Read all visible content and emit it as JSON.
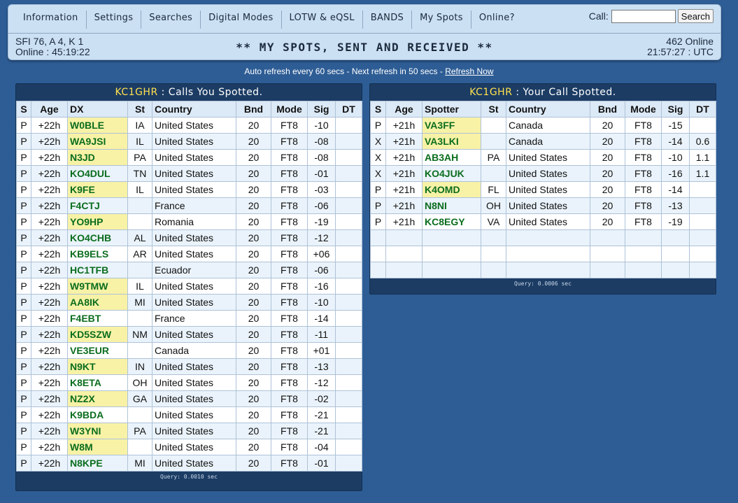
{
  "nav": [
    "Information",
    "Settings",
    "Searches",
    "Digital Modes",
    "LOTW & eQSL",
    "BANDS",
    "My Spots",
    "Online?"
  ],
  "search": {
    "label": "Call:",
    "value": "",
    "button": "Search"
  },
  "solar": {
    "line1": "SFI 76, A 4, K 1",
    "line2": "Online : 45:19:22"
  },
  "title": "** MY SPOTS, SENT AND RECEIVED **",
  "status": {
    "online": "462 Online",
    "time": "21:57:27 : UTC"
  },
  "refresh": {
    "text": "Auto refresh every 60 secs - Next refresh in 50 secs - ",
    "link": "Refresh Now"
  },
  "colors": {
    "background": "#2e5d95",
    "header": "#cbe0f3",
    "panel": "#1c3c64",
    "callsign": "#ffe14d",
    "dx_text": "#0b6d1e",
    "highlight": "#f8f2a6"
  },
  "left": {
    "callsign": "KC1GHR",
    "title": " : Calls You Spotted.",
    "columns": [
      "S",
      "Age",
      "DX",
      "St",
      "Country",
      "Bnd",
      "Mode",
      "Sig",
      "DT"
    ],
    "query": "Query: 0.0010 sec",
    "rows": [
      {
        "s": "P",
        "age": "+22h",
        "call": "W0BLE",
        "st": "IA",
        "country": "United States",
        "band": "20",
        "mode": "FT8",
        "sig": "-10",
        "dt": "",
        "hl": true
      },
      {
        "s": "P",
        "age": "+22h",
        "call": "WA9JSI",
        "st": "IL",
        "country": "United States",
        "band": "20",
        "mode": "FT8",
        "sig": "-08",
        "dt": "",
        "hl": true
      },
      {
        "s": "P",
        "age": "+22h",
        "call": "N3JD",
        "st": "PA",
        "country": "United States",
        "band": "20",
        "mode": "FT8",
        "sig": "-08",
        "dt": "",
        "hl": true
      },
      {
        "s": "P",
        "age": "+22h",
        "call": "KO4DUL",
        "st": "TN",
        "country": "United States",
        "band": "20",
        "mode": "FT8",
        "sig": "-01",
        "dt": "",
        "hl": false
      },
      {
        "s": "P",
        "age": "+22h",
        "call": "K9FE",
        "st": "IL",
        "country": "United States",
        "band": "20",
        "mode": "FT8",
        "sig": "-03",
        "dt": "",
        "hl": true
      },
      {
        "s": "P",
        "age": "+22h",
        "call": "F4CTJ",
        "st": "",
        "country": "France",
        "band": "20",
        "mode": "FT8",
        "sig": "-06",
        "dt": "",
        "hl": false
      },
      {
        "s": "P",
        "age": "+22h",
        "call": "YO9HP",
        "st": "",
        "country": "Romania",
        "band": "20",
        "mode": "FT8",
        "sig": "-19",
        "dt": "",
        "hl": true
      },
      {
        "s": "P",
        "age": "+22h",
        "call": "KO4CHB",
        "st": "AL",
        "country": "United States",
        "band": "20",
        "mode": "FT8",
        "sig": "-12",
        "dt": "",
        "hl": false
      },
      {
        "s": "P",
        "age": "+22h",
        "call": "KB9ELS",
        "st": "AR",
        "country": "United States",
        "band": "20",
        "mode": "FT8",
        "sig": "+06",
        "dt": "",
        "hl": false
      },
      {
        "s": "P",
        "age": "+22h",
        "call": "HC1TFB",
        "st": "",
        "country": "Ecuador",
        "band": "20",
        "mode": "FT8",
        "sig": "-06",
        "dt": "",
        "hl": false
      },
      {
        "s": "P",
        "age": "+22h",
        "call": "W9TMW",
        "st": "IL",
        "country": "United States",
        "band": "20",
        "mode": "FT8",
        "sig": "-16",
        "dt": "",
        "hl": true
      },
      {
        "s": "P",
        "age": "+22h",
        "call": "AA8IK",
        "st": "MI",
        "country": "United States",
        "band": "20",
        "mode": "FT8",
        "sig": "-10",
        "dt": "",
        "hl": true
      },
      {
        "s": "P",
        "age": "+22h",
        "call": "F4EBT",
        "st": "",
        "country": "France",
        "band": "20",
        "mode": "FT8",
        "sig": "-14",
        "dt": "",
        "hl": false
      },
      {
        "s": "P",
        "age": "+22h",
        "call": "KD5SZW",
        "st": "NM",
        "country": "United States",
        "band": "20",
        "mode": "FT8",
        "sig": "-11",
        "dt": "",
        "hl": true
      },
      {
        "s": "P",
        "age": "+22h",
        "call": "VE3EUR",
        "st": "",
        "country": "Canada",
        "band": "20",
        "mode": "FT8",
        "sig": "+01",
        "dt": "",
        "hl": false
      },
      {
        "s": "P",
        "age": "+22h",
        "call": "N9KT",
        "st": "IN",
        "country": "United States",
        "band": "20",
        "mode": "FT8",
        "sig": "-13",
        "dt": "",
        "hl": true
      },
      {
        "s": "P",
        "age": "+22h",
        "call": "K8ETA",
        "st": "OH",
        "country": "United States",
        "band": "20",
        "mode": "FT8",
        "sig": "-12",
        "dt": "",
        "hl": false
      },
      {
        "s": "P",
        "age": "+22h",
        "call": "NZ2X",
        "st": "GA",
        "country": "United States",
        "band": "20",
        "mode": "FT8",
        "sig": "-02",
        "dt": "",
        "hl": true
      },
      {
        "s": "P",
        "age": "+22h",
        "call": "K9BDA",
        "st": "",
        "country": "United States",
        "band": "20",
        "mode": "FT8",
        "sig": "-21",
        "dt": "",
        "hl": false
      },
      {
        "s": "P",
        "age": "+22h",
        "call": "W3YNI",
        "st": "PA",
        "country": "United States",
        "band": "20",
        "mode": "FT8",
        "sig": "-21",
        "dt": "",
        "hl": true
      },
      {
        "s": "P",
        "age": "+22h",
        "call": "W8M",
        "st": "",
        "country": "United States",
        "band": "20",
        "mode": "FT8",
        "sig": "-04",
        "dt": "",
        "hl": true
      },
      {
        "s": "P",
        "age": "+22h",
        "call": "N8KPE",
        "st": "MI",
        "country": "United States",
        "band": "20",
        "mode": "FT8",
        "sig": "-01",
        "dt": "",
        "hl": false
      }
    ]
  },
  "right": {
    "callsign": "KC1GHR",
    "title": " : Your Call Spotted.",
    "columns": [
      "S",
      "Age",
      "Spotter",
      "St",
      "Country",
      "Bnd",
      "Mode",
      "Sig",
      "DT"
    ],
    "query": "Query: 0.0006 sec",
    "empty_rows": 3,
    "rows": [
      {
        "s": "P",
        "age": "+21h",
        "call": "VA3FF",
        "st": "",
        "country": "Canada",
        "band": "20",
        "mode": "FT8",
        "sig": "-15",
        "dt": "",
        "hl": true
      },
      {
        "s": "X",
        "age": "+21h",
        "call": "VA3LKI",
        "st": "",
        "country": "Canada",
        "band": "20",
        "mode": "FT8",
        "sig": "-14",
        "dt": "0.6",
        "hl": true
      },
      {
        "s": "X",
        "age": "+21h",
        "call": "AB3AH",
        "st": "PA",
        "country": "United States",
        "band": "20",
        "mode": "FT8",
        "sig": "-10",
        "dt": "1.1",
        "hl": false
      },
      {
        "s": "X",
        "age": "+21h",
        "call": "KO4JUK",
        "st": "",
        "country": "United States",
        "band": "20",
        "mode": "FT8",
        "sig": "-16",
        "dt": "1.1",
        "hl": false
      },
      {
        "s": "P",
        "age": "+21h",
        "call": "K4OMD",
        "st": "FL",
        "country": "United States",
        "band": "20",
        "mode": "FT8",
        "sig": "-14",
        "dt": "",
        "hl": true
      },
      {
        "s": "P",
        "age": "+21h",
        "call": "N8NI",
        "st": "OH",
        "country": "United States",
        "band": "20",
        "mode": "FT8",
        "sig": "-13",
        "dt": "",
        "hl": false
      },
      {
        "s": "P",
        "age": "+21h",
        "call": "KC8EGY",
        "st": "VA",
        "country": "United States",
        "band": "20",
        "mode": "FT8",
        "sig": "-19",
        "dt": "",
        "hl": false
      }
    ]
  }
}
